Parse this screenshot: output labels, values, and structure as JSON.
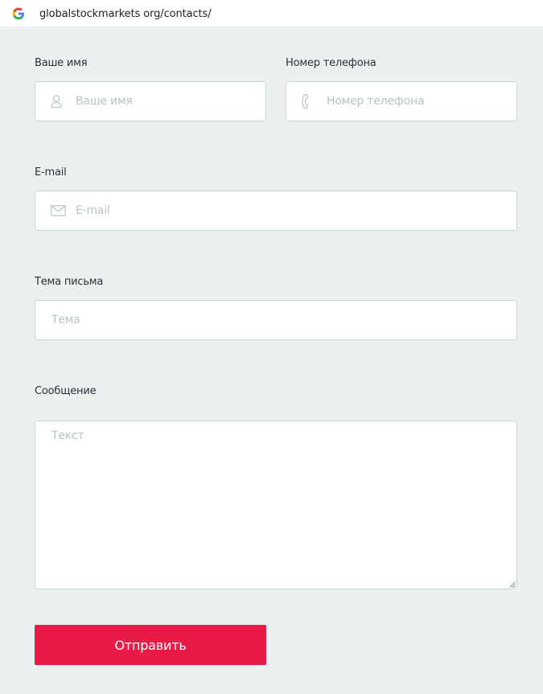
{
  "browser": {
    "url": "globalstockmarkets org/contacts/",
    "icon": "google-g-icon"
  },
  "form": {
    "name": {
      "label": "Ваше имя",
      "placeholder": "Ваше имя",
      "value": "",
      "icon": "user-icon"
    },
    "phone": {
      "label": "Номер телефона",
      "placeholder": "Номер телефона",
      "value": "",
      "icon": "phone-icon"
    },
    "email": {
      "label": "E-mail",
      "placeholder": "E-mail",
      "value": "",
      "icon": "envelope-icon"
    },
    "subject": {
      "label": "Тема письма",
      "placeholder": "Тема",
      "value": ""
    },
    "message": {
      "label": "Сообщение",
      "placeholder": "Текст",
      "value": ""
    },
    "submit_label": "Отправить"
  },
  "colors": {
    "page_background": "#ebf0f1",
    "accent": "#e81b48",
    "input_border": "#c9d6d6",
    "placeholder": "#b7c4c4"
  }
}
